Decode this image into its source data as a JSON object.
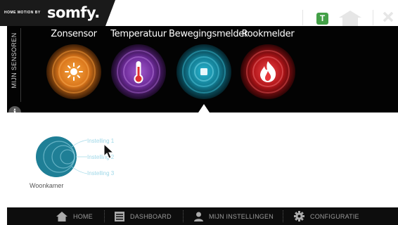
{
  "header": {
    "brand_prefix": "HOME MOTION BY",
    "brand_name": "somfy.",
    "user_badge": "T",
    "icons": [
      "home-icon",
      "close-icon"
    ]
  },
  "sidebar": {
    "label": "MIJN SENSOREN",
    "info_symbol": "i"
  },
  "sensors": [
    {
      "label": "Zonsensor",
      "icon": "sun-icon",
      "color": "#f28c1e"
    },
    {
      "label": "Temperatuur",
      "icon": "thermometer-icon",
      "color": "#8e3fb8"
    },
    {
      "label": "Bewegingsmelder",
      "icon": "motion-icon",
      "color": "#18a3bf",
      "selected": true
    },
    {
      "label": "Rookmelder",
      "icon": "flame-icon",
      "color": "#d91f26"
    }
  ],
  "room": {
    "label": "Woonkamer",
    "color": "#1f7f96",
    "settings": [
      "Instelling 1",
      "Instelling 2",
      "Instelling 3"
    ]
  },
  "footer": {
    "items": [
      {
        "label": "HOME",
        "icon": "home-icon"
      },
      {
        "label": "DASHBOARD",
        "icon": "dashboard-icon"
      },
      {
        "label": "MIJN INSTELLINGEN",
        "icon": "user-icon"
      },
      {
        "label": "CONFIGURATIE",
        "icon": "gear-icon"
      }
    ]
  },
  "colors": {
    "accent_green": "#43a047",
    "band": "#030303",
    "footer": "#0d0d0d"
  }
}
